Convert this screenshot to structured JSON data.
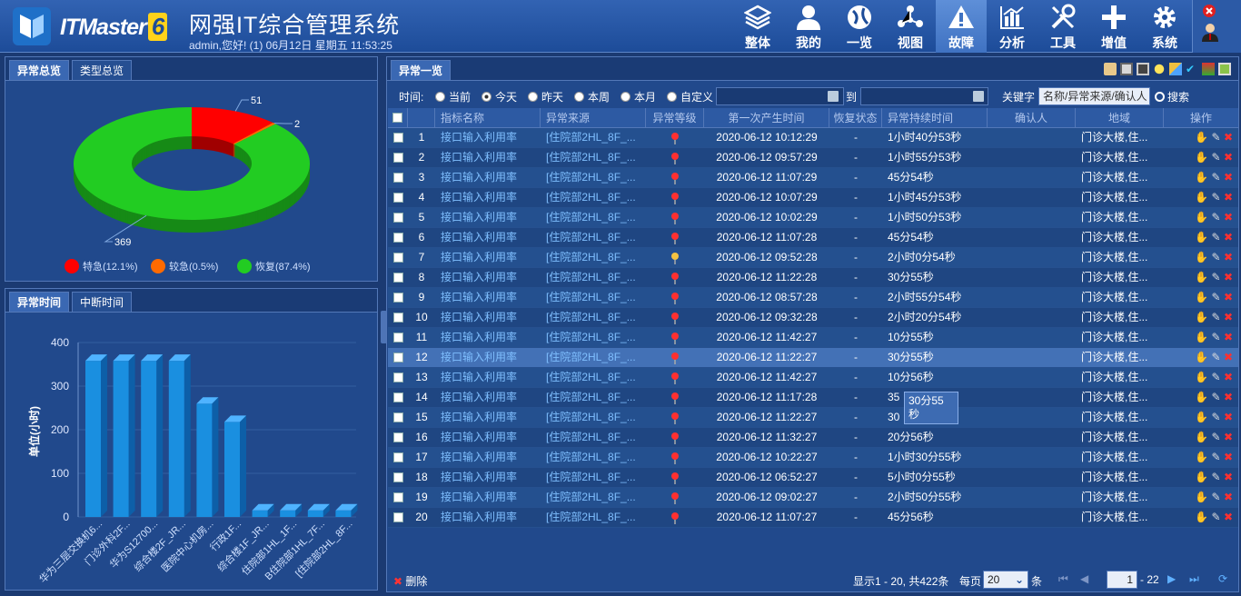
{
  "header": {
    "brand": "ITMaster",
    "brand_version": "6",
    "title": "网强IT综合管理系统",
    "user_info": "admin,您好! (1) 06月12日 星期五 11:53:25",
    "nav": [
      {
        "label": "整体",
        "icon": "layers-icon"
      },
      {
        "label": "我的",
        "icon": "user-icon"
      },
      {
        "label": "一览",
        "icon": "globe-icon"
      },
      {
        "label": "视图",
        "icon": "network-icon"
      },
      {
        "label": "故障",
        "icon": "warning-icon",
        "active": true
      },
      {
        "label": "分析",
        "icon": "bar-chart-icon"
      },
      {
        "label": "工具",
        "icon": "tools-icon"
      },
      {
        "label": "增值",
        "icon": "plus-icon"
      },
      {
        "label": "系统",
        "icon": "gear-icon"
      }
    ]
  },
  "left_top": {
    "tabs": [
      "异常总览",
      "类型总览"
    ],
    "donut": {
      "slices": [
        {
          "name": "特急(12.1%)",
          "value": 51,
          "color": "#ff0000"
        },
        {
          "name": "较急(0.5%)",
          "value": 2,
          "color": "#ff6a00"
        },
        {
          "name": "恢复(87.4%)",
          "value": 369,
          "color": "#22cc22"
        }
      ]
    }
  },
  "left_bottom": {
    "tabs": [
      "异常时间",
      "中断时间"
    ]
  },
  "chart_data": {
    "type": "bar",
    "title": "",
    "xlabel": "",
    "ylabel": "单位(小时)",
    "ylim": [
      0,
      400
    ],
    "yticks": [
      0,
      100,
      200,
      300,
      400
    ],
    "categories": [
      "华为三层交换机6...",
      "门诊外科2F...",
      "华为S12700...",
      "综合楼2F_JR...",
      "医院中心机房...",
      "行政1F...",
      "综合楼1F_JR...",
      "住院部1HL_1F...",
      "B住院部1HL_7F...",
      "[住院部2HL_8F..."
    ],
    "values": [
      358,
      358,
      358,
      358,
      260,
      218,
      15,
      15,
      15,
      15
    ],
    "color": "#1a8fe0"
  },
  "main": {
    "tab": "异常一览",
    "filter": {
      "label": "时间:",
      "options": [
        "当前",
        "今天",
        "昨天",
        "本周",
        "本月",
        "自定义"
      ],
      "selected": "今天",
      "to_label": "到",
      "keyword_label": "关键字",
      "keyword_placeholder": "名称/异常来源/确认人",
      "search_label": "搜索"
    },
    "columns": [
      "指标名称",
      "异常来源",
      "异常等级",
      "第一次产生时间",
      "恢复状态",
      "异常持续时间",
      "确认人",
      "地域",
      "操作"
    ],
    "rows": [
      {
        "n": "1",
        "name": "接口输入利用率",
        "src": "[住院部2HL_8F_...",
        "time": "2020-06-12 10:12:29",
        "st": "-",
        "dur": "1小时40分53秒",
        "loc": "门诊大楼,住..."
      },
      {
        "n": "2",
        "name": "接口输入利用率",
        "src": "[住院部2HL_8F_...",
        "time": "2020-06-12 09:57:29",
        "st": "-",
        "dur": "1小时55分53秒",
        "loc": "门诊大楼,住..."
      },
      {
        "n": "3",
        "name": "接口输入利用率",
        "src": "[住院部2HL_8F_...",
        "time": "2020-06-12 11:07:29",
        "st": "-",
        "dur": "45分54秒",
        "loc": "门诊大楼,住..."
      },
      {
        "n": "4",
        "name": "接口输入利用率",
        "src": "[住院部2HL_8F_...",
        "time": "2020-06-12 10:07:29",
        "st": "-",
        "dur": "1小时45分53秒",
        "loc": "门诊大楼,住..."
      },
      {
        "n": "5",
        "name": "接口输入利用率",
        "src": "[住院部2HL_8F_...",
        "time": "2020-06-12 10:02:29",
        "st": "-",
        "dur": "1小时50分53秒",
        "loc": "门诊大楼,住..."
      },
      {
        "n": "6",
        "name": "接口输入利用率",
        "src": "[住院部2HL_8F_...",
        "time": "2020-06-12 11:07:28",
        "st": "-",
        "dur": "45分54秒",
        "loc": "门诊大楼,住..."
      },
      {
        "n": "7",
        "name": "接口输入利用率",
        "src": "[住院部2HL_8F_...",
        "time": "2020-06-12 09:52:28",
        "st": "-",
        "dur": "2小时0分54秒",
        "loc": "门诊大楼,住...",
        "yellow": true
      },
      {
        "n": "8",
        "name": "接口输入利用率",
        "src": "[住院部2HL_8F_...",
        "time": "2020-06-12 11:22:28",
        "st": "-",
        "dur": "30分55秒",
        "loc": "门诊大楼,住..."
      },
      {
        "n": "9",
        "name": "接口输入利用率",
        "src": "[住院部2HL_8F_...",
        "time": "2020-06-12 08:57:28",
        "st": "-",
        "dur": "2小时55分54秒",
        "loc": "门诊大楼,住..."
      },
      {
        "n": "10",
        "name": "接口输入利用率",
        "src": "[住院部2HL_8F_...",
        "time": "2020-06-12 09:32:28",
        "st": "-",
        "dur": "2小时20分54秒",
        "loc": "门诊大楼,住..."
      },
      {
        "n": "11",
        "name": "接口输入利用率",
        "src": "[住院部2HL_8F_...",
        "time": "2020-06-12 11:42:27",
        "st": "-",
        "dur": "10分55秒",
        "loc": "门诊大楼,住..."
      },
      {
        "n": "12",
        "name": "接口输入利用率",
        "src": "[住院部2HL_8F_...",
        "time": "2020-06-12 11:22:27",
        "st": "-",
        "dur": "30分55秒",
        "loc": "门诊大楼,住...",
        "hl": true
      },
      {
        "n": "13",
        "name": "接口输入利用率",
        "src": "[住院部2HL_8F_...",
        "time": "2020-06-12 11:42:27",
        "st": "-",
        "dur": "10分56秒",
        "loc": "门诊大楼,住..."
      },
      {
        "n": "14",
        "name": "接口输入利用率",
        "src": "[住院部2HL_8F_...",
        "time": "2020-06-12 11:17:28",
        "st": "-",
        "dur": "35",
        "loc": "门诊大楼,住..."
      },
      {
        "n": "15",
        "name": "接口输入利用率",
        "src": "[住院部2HL_8F_...",
        "time": "2020-06-12 11:22:27",
        "st": "-",
        "dur": "30",
        "loc": "门诊大楼,住..."
      },
      {
        "n": "16",
        "name": "接口输入利用率",
        "src": "[住院部2HL_8F_...",
        "time": "2020-06-12 11:32:27",
        "st": "-",
        "dur": "20分56秒",
        "loc": "门诊大楼,住..."
      },
      {
        "n": "17",
        "name": "接口输入利用率",
        "src": "[住院部2HL_8F_...",
        "time": "2020-06-12 10:22:27",
        "st": "-",
        "dur": "1小时30分55秒",
        "loc": "门诊大楼,住..."
      },
      {
        "n": "18",
        "name": "接口输入利用率",
        "src": "[住院部2HL_8F_...",
        "time": "2020-06-12 06:52:27",
        "st": "-",
        "dur": "5小时0分55秒",
        "loc": "门诊大楼,住..."
      },
      {
        "n": "19",
        "name": "接口输入利用率",
        "src": "[住院部2HL_8F_...",
        "time": "2020-06-12 09:02:27",
        "st": "-",
        "dur": "2小时50分55秒",
        "loc": "门诊大楼,住..."
      },
      {
        "n": "20",
        "name": "接口输入利用率",
        "src": "[住院部2HL_8F_...",
        "time": "2020-06-12 11:07:27",
        "st": "-",
        "dur": "45分56秒",
        "loc": "门诊大楼,住..."
      }
    ],
    "tooltip": "30分55秒",
    "footer": {
      "delete_label": "删除",
      "summary": "显示1 - 20, 共422条",
      "per_page_label": "每页",
      "per_page": "20",
      "unit": "条",
      "page": "1",
      "pages": "- 22"
    }
  }
}
